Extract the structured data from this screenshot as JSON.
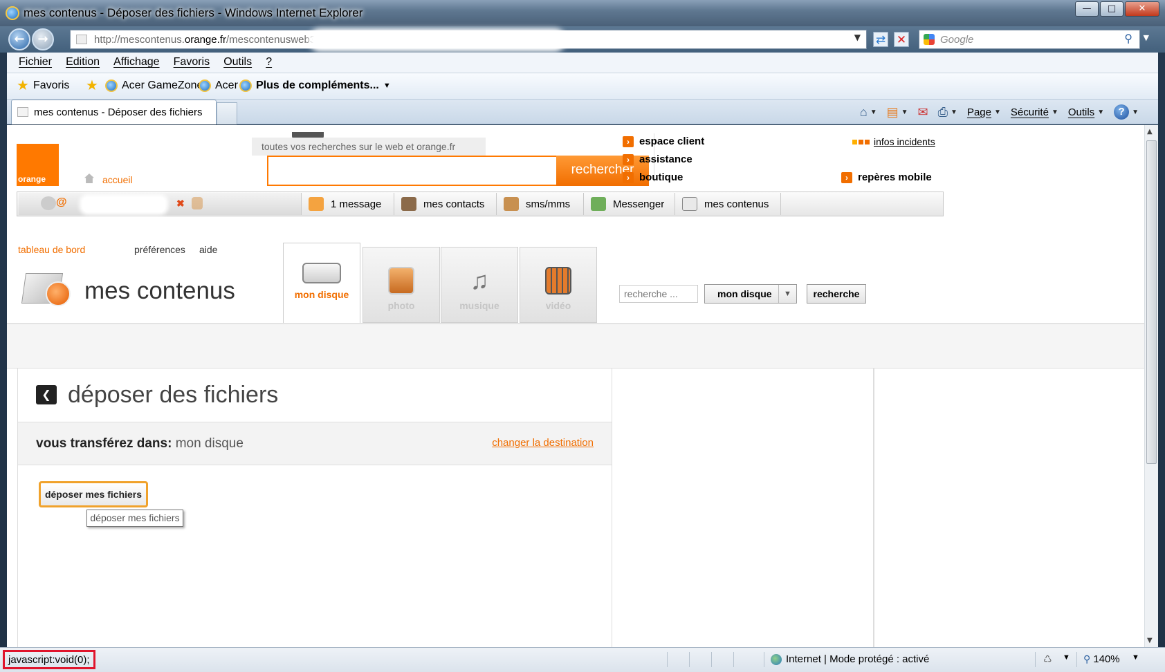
{
  "window": {
    "title": "mes contenus - Déposer des fichiers - Windows Internet Explorer"
  },
  "address": {
    "url_prefix": "http://mescontenus.",
    "url_domain": "orange.fr",
    "url_suffix": "/mescontenusweb3"
  },
  "search": {
    "placeholder": "Google"
  },
  "menu": [
    "Fichier",
    "Edition",
    "Affichage",
    "Favoris",
    "Outils",
    "?"
  ],
  "favbar": {
    "favoris": "Favoris",
    "item1": "Acer GameZone",
    "item2": "Acer",
    "more": "Plus de compléments..."
  },
  "tab": {
    "label": "mes contenus - Déposer des fichiers"
  },
  "commandbar": {
    "page": "Page",
    "securite": "Sécurité",
    "outils": "Outils"
  },
  "orange": {
    "logo_text": "orange",
    "accueil": "accueil",
    "search_hint": "toutes vos recherches sur le web et orange.fr",
    "search_button": "rechercher",
    "links": [
      "espace client",
      "assistance",
      "boutique"
    ],
    "infos": "infos incidents",
    "reperes": "repères mobile"
  },
  "services": {
    "message": "1 message",
    "contacts": "mes contacts",
    "sms": "sms/mms",
    "messenger": "Messenger",
    "contenus": "mes contenus"
  },
  "app": {
    "tableau": "tableau de bord",
    "preferences": "préférences",
    "aide": "aide",
    "title": "mes contenus",
    "categories": [
      "mon disque",
      "photo",
      "musique",
      "vidéo"
    ],
    "search_placeholder": "recherche ...",
    "select_value": "mon disque",
    "search_button": "recherche"
  },
  "panel": {
    "title": "déposer des fichiers",
    "dest_label": "vous transférez dans:",
    "dest_value": "mon disque",
    "change": "changer la destination",
    "upload_button": "déposer mes fichiers",
    "tooltip": "déposer mes fichiers"
  },
  "status": {
    "left": "javascript:void(0);",
    "zone": "Internet | Mode protégé : activé",
    "zoom": "140%"
  }
}
